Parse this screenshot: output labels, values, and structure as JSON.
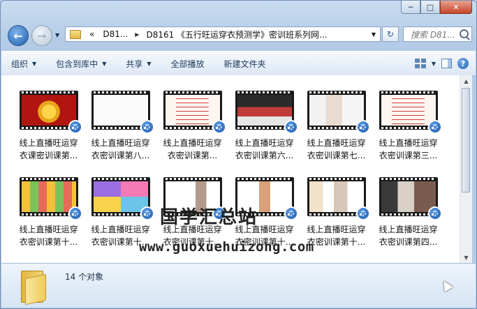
{
  "window": {
    "minimize": "─",
    "maximize": "□",
    "close": "✕"
  },
  "address": {
    "lead": "«",
    "crumbs": [
      "D81...",
      "D8161 《五行旺运穿衣预测学》密训班系列网..."
    ],
    "search_placeholder": "搜索 D81..."
  },
  "toolbar": {
    "organize": "组织",
    "include_library": "包含到库中",
    "share": "共享",
    "play_all": "全部播放",
    "new_folder": "新建文件夹"
  },
  "files": [
    {
      "line1": "线上直播旺运穿",
      "line2": "衣课密训课第...",
      "thumb": "temple"
    },
    {
      "line1": "线上直播旺运穿",
      "line2": "衣密训课第八...",
      "thumb": "white"
    },
    {
      "line1": "线上直播旺运穿",
      "line2": "衣密训课第...",
      "thumb": "text"
    },
    {
      "line1": "线上直播旺运穿",
      "line2": "衣密训课第六...",
      "thumb": "crowd"
    },
    {
      "line1": "线上直播旺运穿",
      "line2": "衣密训课第七...",
      "thumb": "fashion"
    },
    {
      "line1": "线上直播旺运穿",
      "line2": "衣密训课第三...",
      "thumb": "text"
    },
    {
      "line1": "线上直播旺运穿",
      "line2": "衣密训课第十...",
      "thumb": "chart"
    },
    {
      "line1": "线上直播旺运穿",
      "line2": "衣密训课第十...",
      "thumb": "colors"
    },
    {
      "line1": "线上直播旺运穿",
      "line2": "衣密训课第十...",
      "thumb": "slide"
    },
    {
      "line1": "线上直播旺运穿",
      "line2": "衣密训课第十...",
      "thumb": "slide2"
    },
    {
      "line1": "线上直播旺运穿",
      "line2": "衣密训课第十...",
      "thumb": "clothes"
    },
    {
      "line1": "线上直播旺运穿",
      "line2": "衣密训课第四...",
      "thumb": "photos"
    }
  ],
  "watermark": {
    "title": "国学汇总站",
    "url": "www.guoxuehuizong.com"
  },
  "status": {
    "count": "14 个对象"
  },
  "colors": {
    "accent": "#1d5fae",
    "toolbar_text": "#1e395b"
  }
}
